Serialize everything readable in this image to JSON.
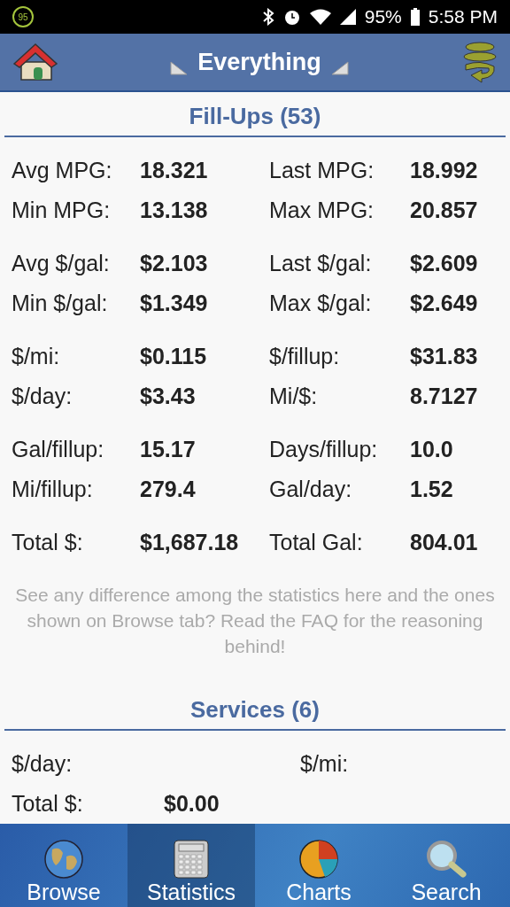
{
  "status_bar": {
    "badge": "95",
    "battery": "95%",
    "time": "5:58 PM"
  },
  "header": {
    "title": "Everything"
  },
  "fillups": {
    "title": "Fill-Ups (53)",
    "groups": [
      [
        [
          {
            "label": "Avg MPG:",
            "value": "18.321"
          },
          {
            "label": "Last MPG:",
            "value": "18.992"
          }
        ],
        [
          {
            "label": "Min MPG:",
            "value": "13.138"
          },
          {
            "label": "Max MPG:",
            "value": "20.857"
          }
        ]
      ],
      [
        [
          {
            "label": "Avg $/gal:",
            "value": "$2.103"
          },
          {
            "label": "Last $/gal:",
            "value": "$2.609"
          }
        ],
        [
          {
            "label": "Min $/gal:",
            "value": "$1.349"
          },
          {
            "label": "Max $/gal:",
            "value": "$2.649"
          }
        ]
      ],
      [
        [
          {
            "label": "$/mi:",
            "value": "$0.115"
          },
          {
            "label": "$/fillup:",
            "value": "$31.83"
          }
        ],
        [
          {
            "label": "$/day:",
            "value": "$3.43"
          },
          {
            "label": "Mi/$:",
            "value": "8.7127"
          }
        ]
      ],
      [
        [
          {
            "label": "Gal/fillup:",
            "value": "15.17"
          },
          {
            "label": "Days/fillup:",
            "value": "10.0"
          }
        ],
        [
          {
            "label": "Mi/fillup:",
            "value": "279.4"
          },
          {
            "label": "Gal/day:",
            "value": "1.52"
          }
        ]
      ],
      [
        [
          {
            "label": "Total $:",
            "value": "$1,687.18"
          },
          {
            "label": "Total Gal:",
            "value": "804.01"
          }
        ]
      ]
    ],
    "note": "See any difference among the statistics here and the ones shown on Browse tab? Read the FAQ for the reasoning behind!"
  },
  "services": {
    "title": "Services (6)",
    "rows": [
      [
        {
          "label": "$/day:"
        },
        {
          "label": "$/mi:"
        }
      ],
      [
        {
          "label": "Total $:",
          "value": "$0.00"
        }
      ]
    ]
  },
  "tabs": [
    {
      "label": "Browse",
      "kind": "globe",
      "selected": false
    },
    {
      "label": "Statistics",
      "kind": "calculator",
      "selected": true
    },
    {
      "label": "Charts",
      "kind": "pie",
      "selected": false
    },
    {
      "label": "Search",
      "kind": "magnifier",
      "selected": false
    }
  ]
}
